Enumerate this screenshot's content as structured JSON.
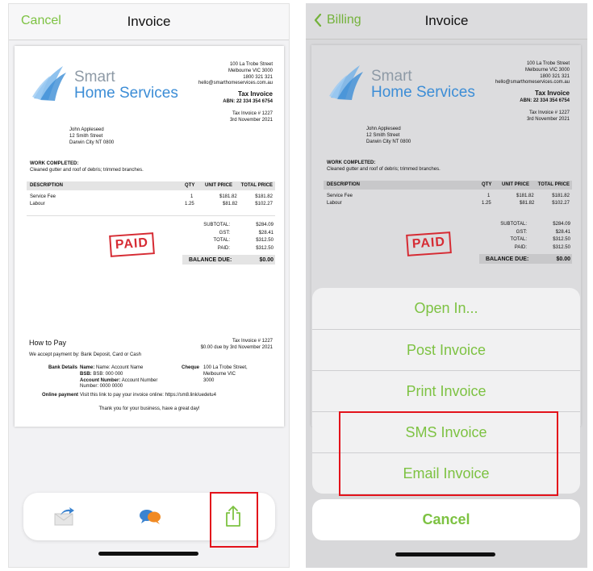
{
  "left_screen": {
    "nav": {
      "cancel_label": "Cancel",
      "title": "Invoice"
    },
    "toolbar": {
      "icons": [
        "mail-forward-icon",
        "chat-bubbles-icon",
        "share-icon"
      ]
    }
  },
  "right_screen": {
    "nav": {
      "back_label": "Billing",
      "title": "Invoice"
    },
    "share_sheet": {
      "items": [
        "Open In...",
        "Post Invoice",
        "Print Invoice",
        "SMS Invoice",
        "Email Invoice"
      ],
      "cancel_label": "Cancel"
    }
  },
  "invoice": {
    "logo_line1": "Smart",
    "logo_line2": "Home Services",
    "address_lines": [
      "100 La Trobe Street",
      "Melbourne VIC 3000",
      "1800 321 321",
      "hello@smarthomeservices.com.au"
    ],
    "doc_title": "Tax Invoice",
    "abn": "ABN: 22 334 354 6754",
    "invoice_no": "Tax Invoice # 1227",
    "date": "3rd November 2021",
    "customer_lines": [
      "John Appleseed",
      "12 Smith Street",
      "Darwin City NT 0800"
    ],
    "work_label": "WORK COMPLETED:",
    "work_text": "Cleaned gutter and roof of debris; trimmed branches.",
    "headers": {
      "description": "DESCRIPTION",
      "qty": "QTY",
      "unit_price": "UNIT PRICE",
      "total_price": "TOTAL PRICE"
    },
    "rows": [
      {
        "description": "Service Fee",
        "qty": "1",
        "unit_price": "$181.82",
        "total_price": "$181.82"
      },
      {
        "description": "Labour",
        "qty": "1.25",
        "unit_price": "$81.82",
        "total_price": "$102.27"
      }
    ],
    "totals": [
      {
        "label": "SUBTOTAL:",
        "value": "$284.09"
      },
      {
        "label": "GST:",
        "value": "$28.41"
      },
      {
        "label": "TOTAL:",
        "value": "$312.50"
      },
      {
        "label": "PAID:",
        "value": "$312.50"
      }
    ],
    "balance_label": "BALANCE DUE:",
    "balance_value": "$0.00",
    "stamp": "PAID",
    "how_to_pay": "How to Pay",
    "pay_ref_line1": "Tax Invoice # 1227",
    "pay_ref_line2": "$0.00 due by 3rd November 2021",
    "pay_methods": "We accept payment by: Bank Deposit, Card or Cash",
    "bank_label": "Bank Details",
    "bank_name_label": "Name:",
    "bank_name": "Name: Account Name",
    "bsb_label": "BSB:",
    "bsb": "BSB: 000 000",
    "acct_label": "Account Number:",
    "acct_value": "Account Number",
    "acct_number": "Number: 0000 0000",
    "cheque_label": "Cheque",
    "cheque_lines": [
      "100 La Trobe Street,",
      "Melbourne VIC",
      "3000"
    ],
    "online_label": "Online payment",
    "online_text": "Visit this link to pay your invoice online: https://sm8.link/uedetu4",
    "thanks": "Thank you for your business, have a great day!"
  },
  "colors": {
    "accent": "#7dc242",
    "highlight": "#e3121b",
    "stamp": "#d62b33",
    "logo_blue": "#3c8dd6"
  }
}
